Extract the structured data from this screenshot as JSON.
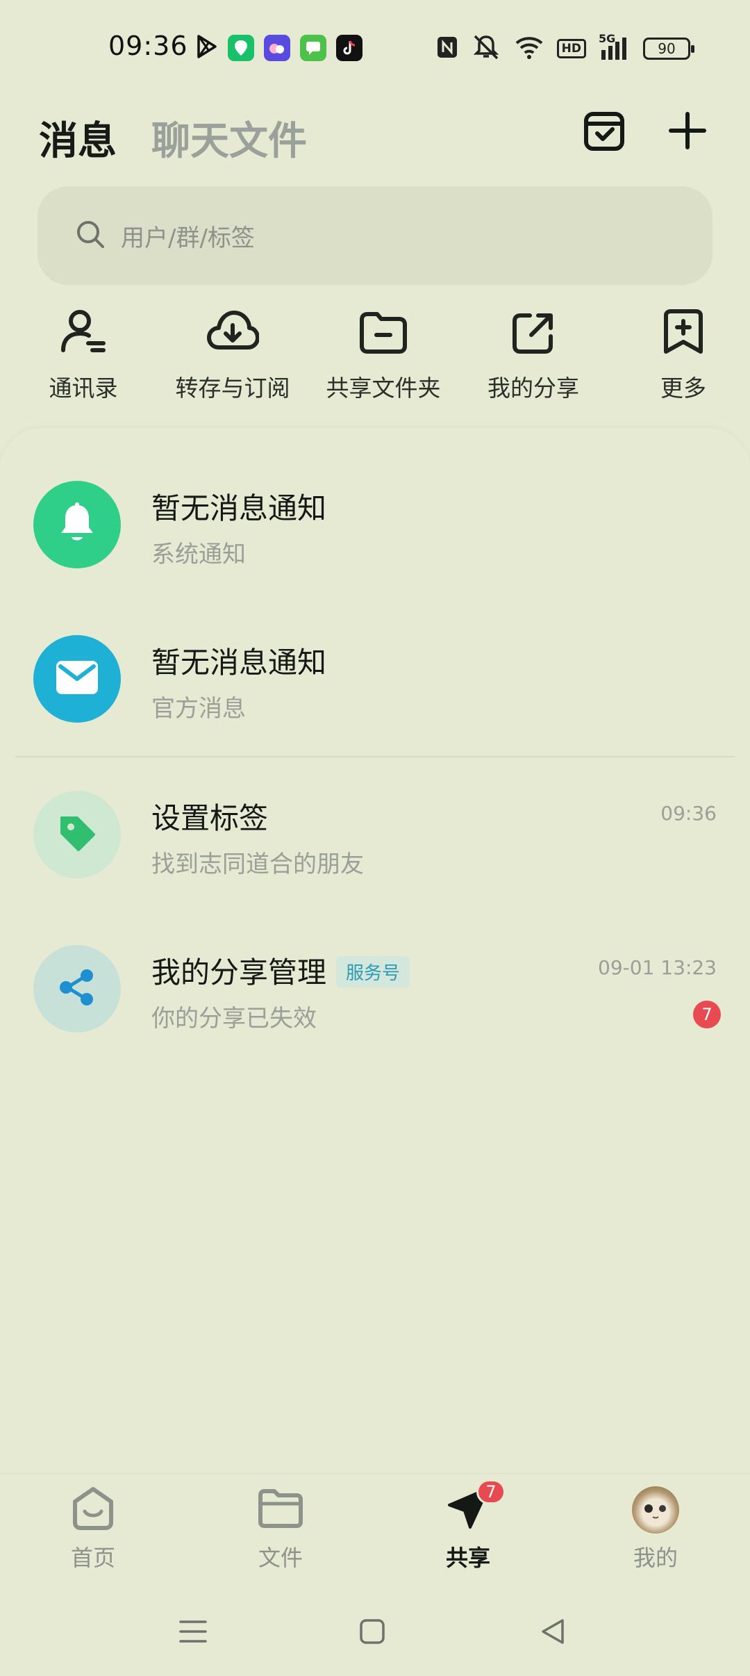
{
  "status_bar": {
    "time": "09:36",
    "network": "5G",
    "hd": "HD",
    "battery": "90",
    "icons": [
      "play-store-icon",
      "maps-app-icon",
      "weather-app-icon",
      "messages-app-icon",
      "tiktok-icon",
      "nfc-icon",
      "mute-icon",
      "wifi-icon",
      "hd-icon",
      "signal-icon",
      "battery-icon"
    ]
  },
  "header": {
    "tab_active": "消息",
    "tab_inactive": "聊天文件",
    "icons": [
      "calendar-check-icon",
      "plus-icon"
    ]
  },
  "search": {
    "placeholder": "用户/群/标签"
  },
  "quick_actions": [
    {
      "label": "通讯录",
      "icon": "contacts-icon"
    },
    {
      "label": "转存与订阅",
      "icon": "cloud-download-icon"
    },
    {
      "label": "共享文件夹",
      "icon": "shared-folder-icon"
    },
    {
      "label": "我的分享",
      "icon": "share-out-icon"
    },
    {
      "label": "更多",
      "icon": "bookmark-plus-icon"
    }
  ],
  "messages": [
    {
      "title": "暂无消息通知",
      "subtitle": "系统通知",
      "icon": "bell-icon",
      "color": "#2fcf8a"
    },
    {
      "title": "暂无消息通知",
      "subtitle": "官方消息",
      "icon": "mail-icon",
      "color": "#1fb0d6"
    },
    {
      "title": "设置标签",
      "subtitle": "找到志同道合的朋友",
      "time": "09:36",
      "icon": "tag-icon",
      "color": "#cfe8d2"
    },
    {
      "title": "我的分享管理",
      "badge": "服务号",
      "subtitle": "你的分享已失效",
      "time": "09-01 13:23",
      "unread": "7",
      "icon": "share-nodes-icon",
      "color": "#c7e1d8"
    }
  ],
  "bottom_nav": [
    {
      "label": "首页",
      "icon": "home-icon"
    },
    {
      "label": "文件",
      "icon": "folder-icon"
    },
    {
      "label": "共享",
      "icon": "send-icon",
      "badge": "7",
      "active": true
    },
    {
      "label": "我的",
      "icon": "avatar"
    }
  ],
  "system_nav": [
    "menu-icon",
    "home-square-icon",
    "back-icon"
  ],
  "colors": {
    "background": "#e7ead2",
    "accent": "#2fcf8a",
    "badge": "#e84a52"
  }
}
